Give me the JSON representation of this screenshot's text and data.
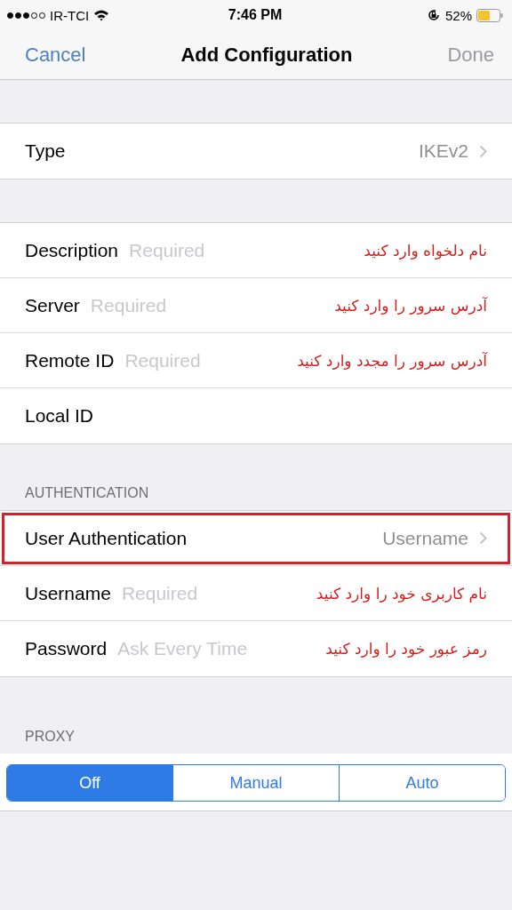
{
  "status_bar": {
    "carrier": "IR-TCI",
    "time": "7:46 PM",
    "battery": "52%"
  },
  "nav": {
    "cancel": "Cancel",
    "title": "Add Configuration",
    "done": "Done",
    "done_disabled": true
  },
  "type_row": {
    "label": "Type",
    "value": "IKEv2"
  },
  "fields": [
    {
      "label": "Description",
      "placeholder": "Required",
      "note": "نام دلخواه وارد کنید"
    },
    {
      "label": "Server",
      "placeholder": "Required",
      "note": "آدرس سرور را وارد کنید"
    },
    {
      "label": "Remote ID",
      "placeholder": "Required",
      "note": "آدرس سرور را مجدد وارد کنید"
    },
    {
      "label": "Local ID"
    }
  ],
  "authentication": {
    "header": "AUTHENTICATION",
    "user_auth": {
      "label": "User Authentication",
      "value": "Username",
      "highlighted": true
    },
    "fields": [
      {
        "label": "Username",
        "placeholder": "Required",
        "note": "نام کاربری خود را وارد کنید"
      },
      {
        "label": "Password",
        "placeholder": "Ask Every Time",
        "note": "رمز عبور خود را وارد کنید"
      }
    ]
  },
  "proxy": {
    "header": "PROXY",
    "options": [
      {
        "label": "Off",
        "selected": true
      },
      {
        "label": "Manual",
        "selected": false
      },
      {
        "label": "Auto",
        "selected": false
      }
    ]
  }
}
